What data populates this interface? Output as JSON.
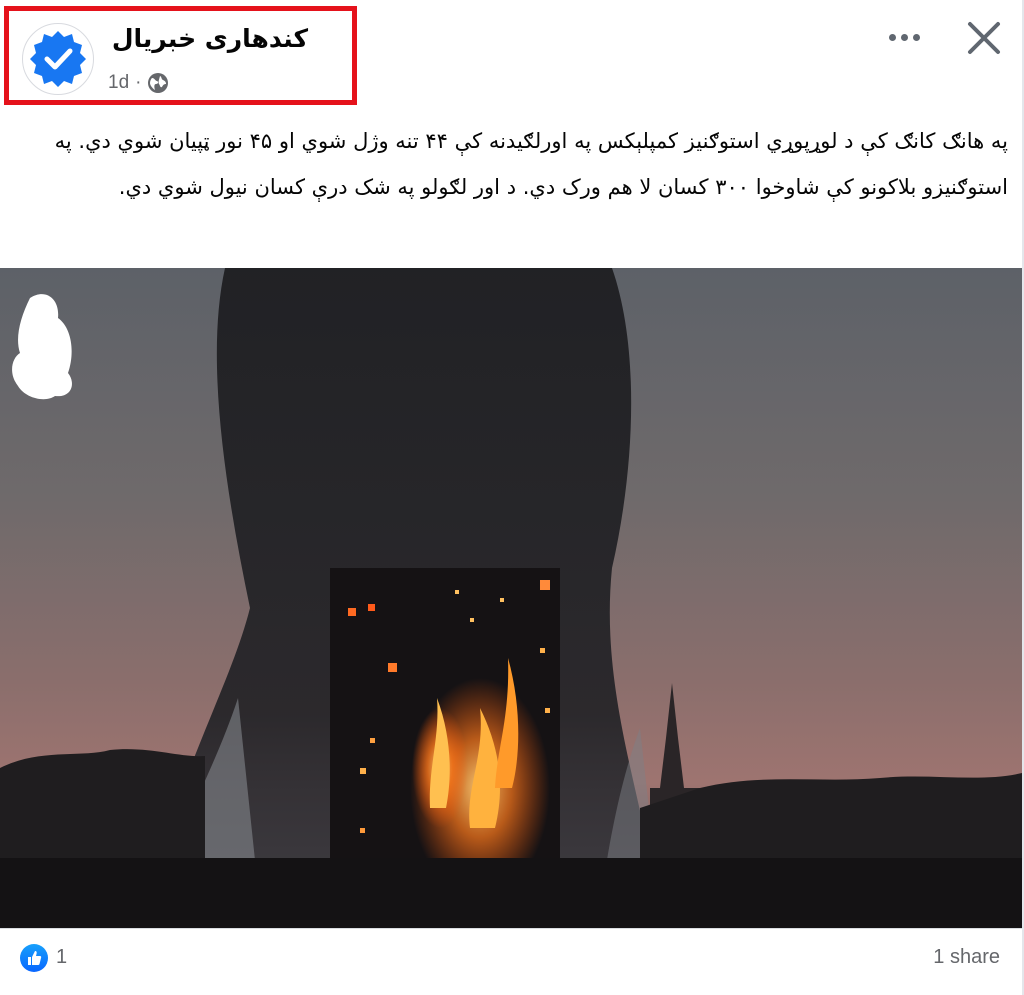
{
  "post": {
    "page_name": "کندهاری خبریال",
    "time": "1d",
    "separator": "·",
    "text": "په هانګ کانګ کې د لوړپوړي استوګنیز کمپلېکس په اورلګیدنه کې ۴۴ تنه وژل شوي او ۴۵ نور ټپیان شوي دي.  په استوګنیزو بلاکونو کې شاوخوا ۳۰۰ کسان لا هم ورک دي. د اور لګولو په شک درې کسان نیول شوي دي."
  },
  "footer": {
    "reaction_count": "1",
    "share_label": "1 share"
  },
  "colors": {
    "highlight": "#e5121b",
    "verified_badge": "#1877f2",
    "like_blue": "#0866ff"
  },
  "icons": [
    "verified-badge-icon",
    "globe-icon",
    "more-options-icon",
    "close-icon",
    "like-icon"
  ]
}
